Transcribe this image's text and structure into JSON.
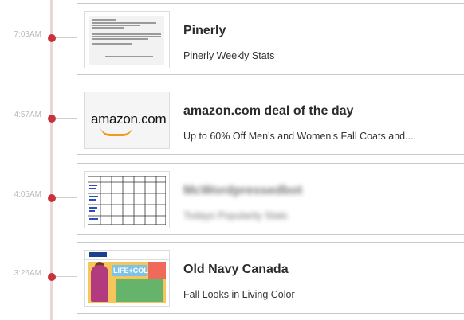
{
  "entries": [
    {
      "time": "7:03AM",
      "title": "Pinerly",
      "subtitle": "Pinerly Weekly Stats",
      "thumb": "email-preview"
    },
    {
      "time": "4:57AM",
      "title": "amazon.com deal of the day",
      "subtitle": "Up to 60% Off Men's and Women's Fall Coats and....",
      "thumb": "amazon-logo",
      "thumb_text": "amazon.com"
    },
    {
      "time": "4:05AM",
      "title": "McWordpressedbot",
      "subtitle": "Todays Popularity Stats",
      "thumb": "spreadsheet-preview",
      "blurred": true
    },
    {
      "time": "3:26AM",
      "title": "Old Navy Canada",
      "subtitle": "Fall Looks in Living Color",
      "thumb": "old-navy-promo",
      "thumb_text": "LIFE+COLOR"
    }
  ],
  "colors": {
    "dot": "#c8323a",
    "timeline": "#ead6d6",
    "amazon_smile": "#f39a1e"
  }
}
